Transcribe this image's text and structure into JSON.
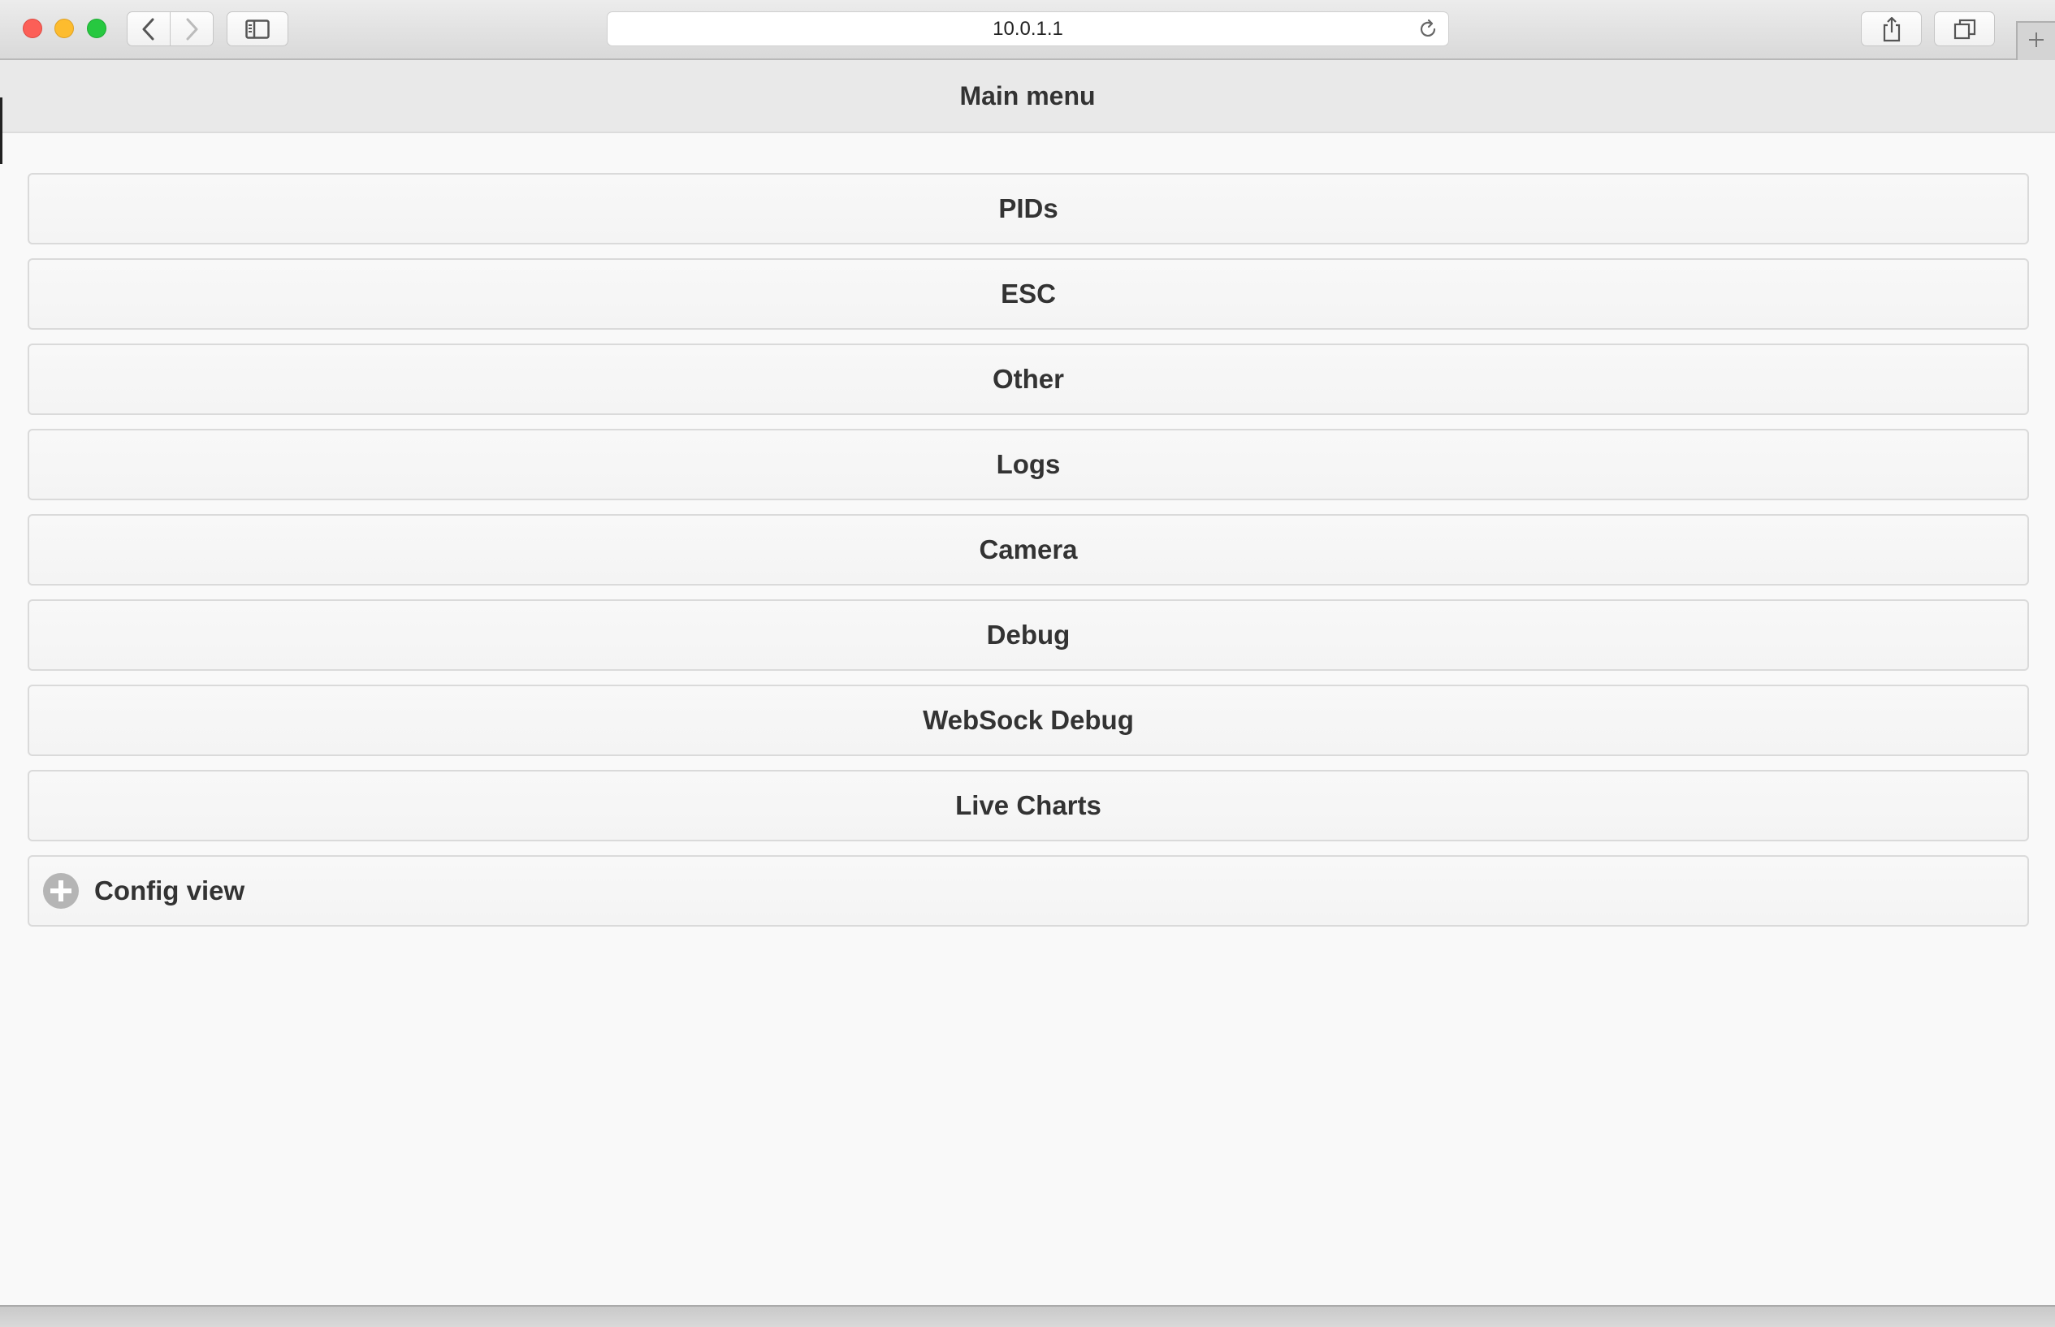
{
  "browser": {
    "address": "10.0.1.1",
    "icons": {
      "back": "chevron-left-icon",
      "forward": "chevron-right-icon",
      "sidebar": "sidebar-icon",
      "reload": "reload-icon",
      "share": "share-icon",
      "tabs": "tabs-overview-icon",
      "new_tab": "plus-icon"
    },
    "traffic_lights": [
      "#fc5f57",
      "#fdbc2e",
      "#27c840"
    ]
  },
  "header": {
    "title": "Main menu"
  },
  "menu": {
    "items": [
      {
        "label": "PIDs"
      },
      {
        "label": "ESC"
      },
      {
        "label": "Other"
      },
      {
        "label": "Logs"
      },
      {
        "label": "Camera"
      },
      {
        "label": "Debug"
      },
      {
        "label": "WebSock Debug"
      },
      {
        "label": "Live Charts"
      }
    ],
    "config": {
      "label": "Config view",
      "icon": "plus-circle-icon",
      "expanded": false
    }
  }
}
